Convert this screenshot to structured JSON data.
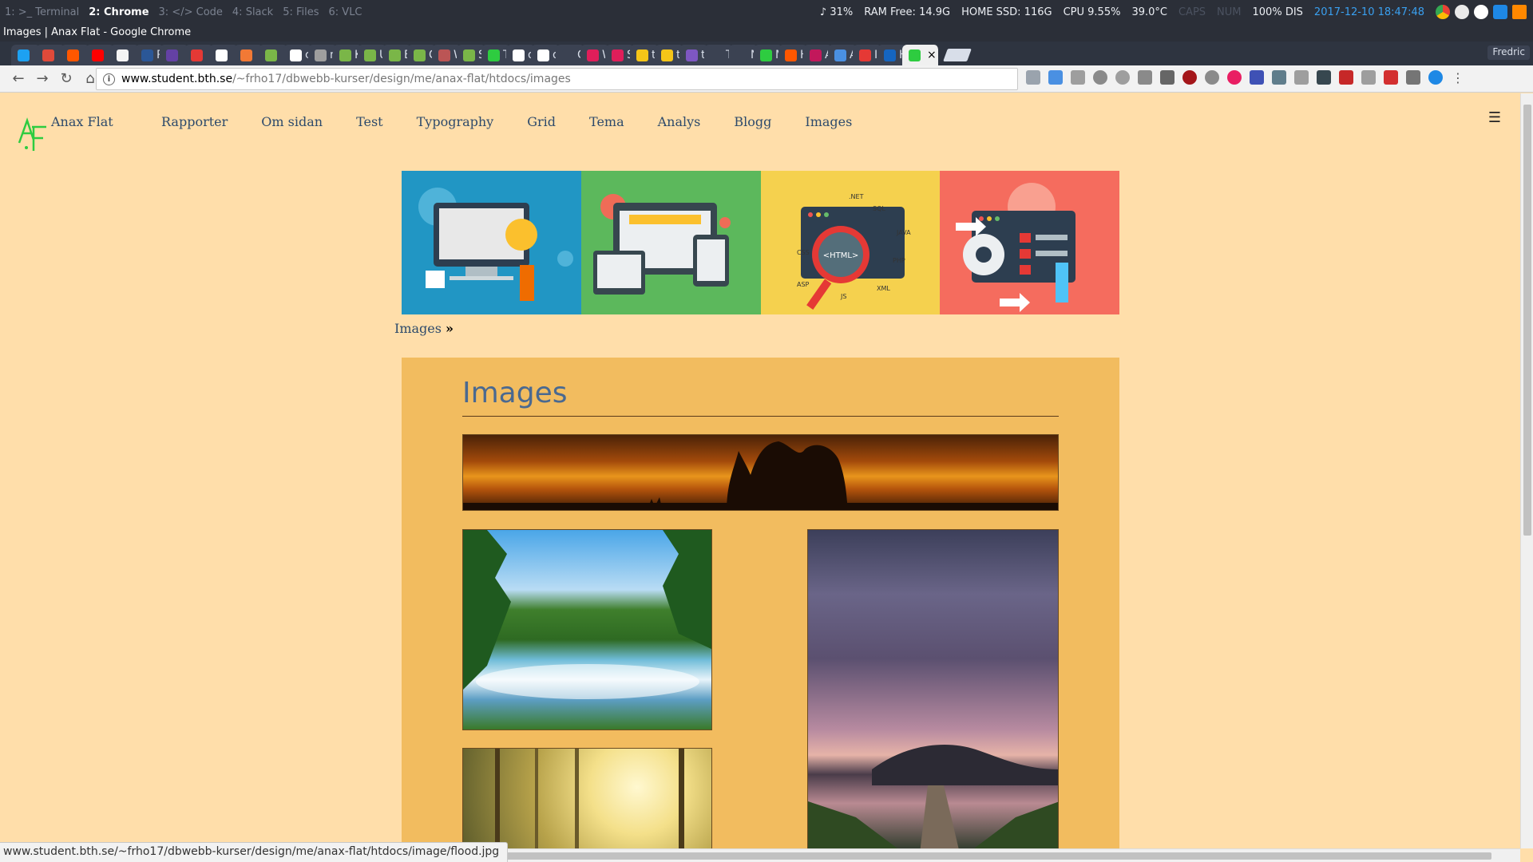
{
  "i3": {
    "workspaces": [
      "1: >_ Terminal",
      "2: Chrome",
      "3: </> Code",
      "4: Slack",
      "5: Files",
      "6: VLC"
    ],
    "active_workspace": "2: Chrome",
    "volume": "♪ 31%",
    "ram": "RAM Free: 14.9G",
    "disk": "HOME SSD: 116G",
    "cpu": "CPU 9.55%",
    "temp": "39.0°C",
    "caps": "CAPS",
    "num": "NUM",
    "battery": "100% DIS",
    "datetime": "2017-12-10 18:47:48"
  },
  "window_title": "Images | Anax Flat - Google Chrome",
  "tabs": [
    {
      "label": "",
      "color": "#1da1f2"
    },
    {
      "label": "",
      "color": "#e04a3a"
    },
    {
      "label": "",
      "color": "#ff5700"
    },
    {
      "label": "",
      "color": "#ff0000"
    },
    {
      "label": "",
      "color": "#f4f4f4"
    },
    {
      "label": "R",
      "color": "#2b5797"
    },
    {
      "label": "",
      "color": "#6441a5"
    },
    {
      "label": "",
      "color": "#e53935"
    },
    {
      "label": "",
      "color": "#ffffff"
    },
    {
      "label": "",
      "color": "#f27935"
    },
    {
      "label": "",
      "color": "#7ab648"
    },
    {
      "label": "ch",
      "color": "#ffffff"
    },
    {
      "label": "m",
      "color": "#9e9e9e"
    },
    {
      "label": "Kr",
      "color": "#7ab648"
    },
    {
      "label": "Ut",
      "color": "#7ab648"
    },
    {
      "label": "By",
      "color": "#7ab648"
    },
    {
      "label": "Cl",
      "color": "#7ab648"
    },
    {
      "label": "W",
      "color": "#b55"
    },
    {
      "label": "Sl",
      "color": "#7ab648"
    },
    {
      "label": "Te",
      "color": "#2ecc40"
    },
    {
      "label": "os",
      "color": "#ffffff"
    },
    {
      "label": "os",
      "color": "#ffffff"
    },
    {
      "label": "Or",
      "color": "#3b4252"
    },
    {
      "label": "W",
      "color": "#e01e5a"
    },
    {
      "label": "Sl",
      "color": "#e01e5a"
    },
    {
      "label": "tic",
      "color": "#f5c518"
    },
    {
      "label": "tic",
      "color": "#f5c518"
    },
    {
      "label": "tic",
      "color": "#7e57c2"
    },
    {
      "label": "Ti",
      "color": "#3b4252"
    },
    {
      "label": "New",
      "color": "#3b4252"
    },
    {
      "label": "M",
      "color": "#2ecc40"
    },
    {
      "label": "H",
      "color": "#ff5700"
    },
    {
      "label": "Ap",
      "color": "#c2185b"
    },
    {
      "label": "Ar",
      "color": "#4a90e2"
    },
    {
      "label": "In",
      "color": "#e53935"
    },
    {
      "label": "H",
      "color": "#1565c0"
    },
    {
      "label": "",
      "color": "#2ecc40",
      "active": true
    }
  ],
  "profile_name": "Fredric",
  "url": {
    "host": "www.student.bth.se",
    "path": "/~frho17/dbwebb-kurser/design/me/anax-flat/htdocs/images"
  },
  "site": {
    "logo_text": "AF",
    "title": "Anax Flat",
    "nav": [
      "Rapporter",
      "Om sidan",
      "Test",
      "Typography",
      "Grid",
      "Tema",
      "Analys",
      "Blogg",
      "Images"
    ],
    "breadcrumb": "Images",
    "breadcrumb_sep": "»",
    "heading": "Images"
  },
  "colors": {
    "page_bg": "#ffdeaa",
    "content_bg": "#f2bc5f",
    "link": "#2d4a6b",
    "heading": "#4a6990",
    "logo": "#2ecc40"
  },
  "status_url": "www.student.bth.se/~frho17/dbwebb-kurser/design/me/anax-flat/htdocs/image/flood.jpg"
}
